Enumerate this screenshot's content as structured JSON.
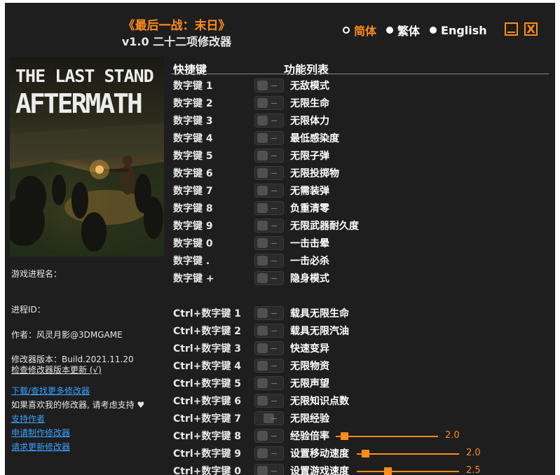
{
  "header": {
    "title": "《最后一战：末日》",
    "subtitle": "v1.0 二十二项修改器"
  },
  "languages": [
    {
      "label": "简体",
      "active": true
    },
    {
      "label": "繁体",
      "active": false
    },
    {
      "label": "English",
      "active": false
    }
  ],
  "window": {
    "close_label": "X"
  },
  "cover": {
    "line1": "THE LAST STAND",
    "line2": "AFTERMATH"
  },
  "info": {
    "process_name_label": "游戏进程名：",
    "process_id_label": "进程ID：",
    "author": "作者：风灵月影@3DMGAME",
    "version": "修改器版本：Build.2021.11.20",
    "check_update": "检查修改器版本更新 (√)",
    "download_more": "下载/查找更多修改器",
    "support_text": "如果喜欢我的修改器, 请考虑支持",
    "heart": "♥",
    "support_author": "支持作者",
    "request_custom": "申请制作修改器",
    "request_update": "请求更新修改器"
  },
  "columns": {
    "hotkey": "快捷键",
    "features": "功能列表"
  },
  "cheats_group1": [
    {
      "key": "数字键 1",
      "feature": "无敌模式"
    },
    {
      "key": "数字键 2",
      "feature": "无限生命"
    },
    {
      "key": "数字键 3",
      "feature": "无限体力"
    },
    {
      "key": "数字键 4",
      "feature": "最低感染度"
    },
    {
      "key": "数字键 5",
      "feature": "无限子弹"
    },
    {
      "key": "数字键 6",
      "feature": "无限投掷物"
    },
    {
      "key": "数字键 7",
      "feature": "无需装弹"
    },
    {
      "key": "数字键 8",
      "feature": "负重清零"
    },
    {
      "key": "数字键 9",
      "feature": "无限武器耐久度"
    },
    {
      "key": "数字键 0",
      "feature": "一击击晕"
    },
    {
      "key": "数字键 .",
      "feature": "一击必杀"
    },
    {
      "key": "数字键 +",
      "feature": "隐身模式"
    }
  ],
  "cheats_group2": [
    {
      "key": "Ctrl+数字键 1",
      "feature": "载具无限生命"
    },
    {
      "key": "Ctrl+数字键 2",
      "feature": "载具无限汽油"
    },
    {
      "key": "Ctrl+数字键 3",
      "feature": "快速变异"
    },
    {
      "key": "Ctrl+数字键 4",
      "feature": "无限物资"
    },
    {
      "key": "Ctrl+数字键 5",
      "feature": "无限声望"
    },
    {
      "key": "Ctrl+数字键 6",
      "feature": "无限知识点数"
    },
    {
      "key": "Ctrl+数字键 7",
      "feature": "无限经验"
    }
  ],
  "slider_cheats": [
    {
      "key": "Ctrl+数字键 8",
      "feature": "经验倍率",
      "value": "2.0",
      "fraction": 0.08
    },
    {
      "key": "Ctrl+数字键 9",
      "feature": "设置移动速度",
      "value": "2.0",
      "fraction": 0.08
    },
    {
      "key": "Ctrl+数字键 0",
      "feature": "设置游戏速度",
      "value": "2.5",
      "fraction": 0.3
    }
  ],
  "colors": {
    "accent": "#ff8c1a",
    "background": "#1e1e1e",
    "link": "#3aa0ff"
  }
}
